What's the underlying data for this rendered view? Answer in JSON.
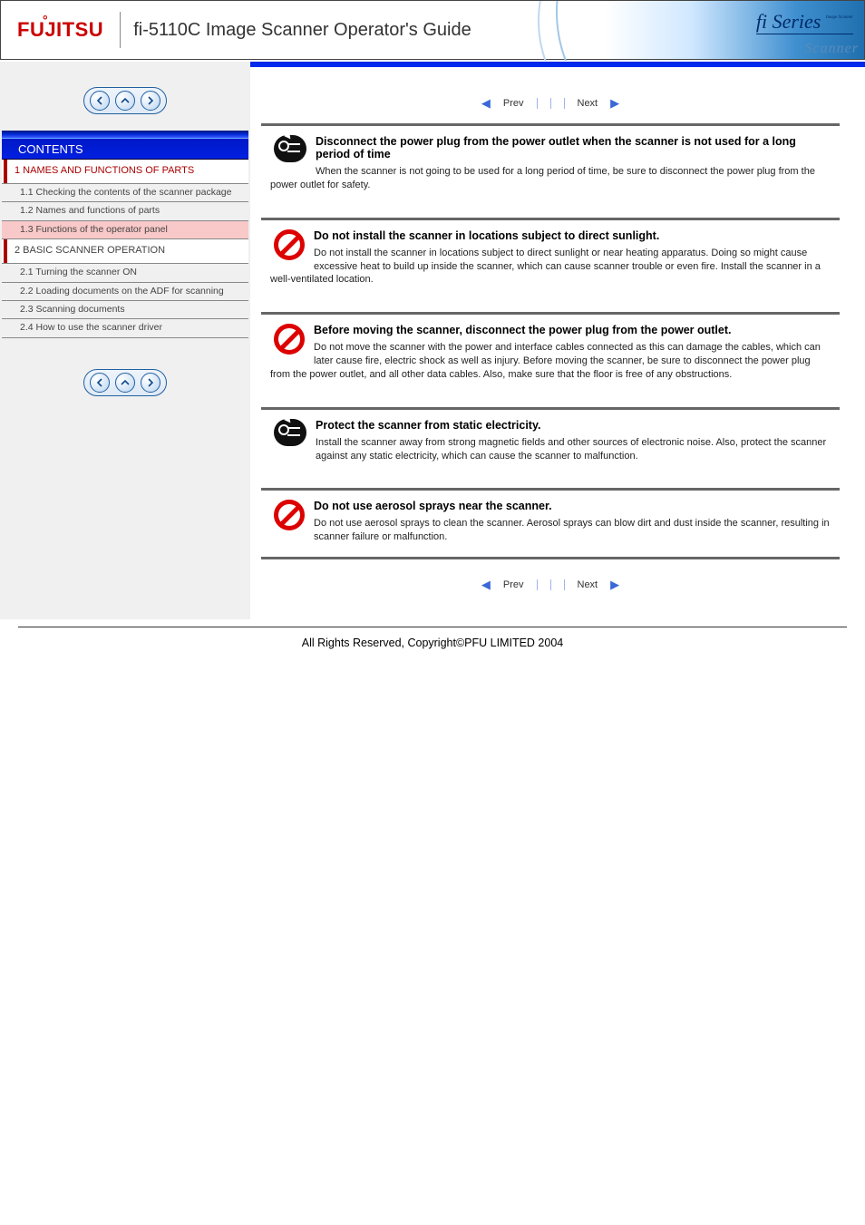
{
  "header": {
    "logo": "FUJITSU",
    "title": "fi-5110C  Image Scanner Operator's Guide",
    "series_label": "fi Series",
    "series_small": "Image Scanner",
    "banner_script": "Scanner"
  },
  "sidebar": {
    "contents_label": "CONTENTS",
    "section_header": "1 NAMES AND FUNCTIONS OF PARTS",
    "items": [
      {
        "label": "1.1 Checking the contents of the scanner package",
        "active": false
      },
      {
        "label": "1.2 Names and functions of parts",
        "active": false
      },
      {
        "label": "1.3 Functions of the operator panel",
        "active": true
      }
    ],
    "section_header_2": "2 BASIC SCANNER OPERATION",
    "items2": [
      {
        "label": "2.1 Turning the scanner ON"
      },
      {
        "label": "2.2 Loading documents on the ADF for scanning"
      },
      {
        "label": "2.3 Scanning documents"
      },
      {
        "label": "2.4 How to use the scanner driver"
      }
    ]
  },
  "pager_top": {
    "prev": "Prev",
    "next": "Next"
  },
  "boxes": [
    {
      "icon": "plug",
      "title": "Disconnect the power plug from the power outlet when the scanner is not used for a long period of time",
      "text": "When the scanner is not going to be used for a long period of time, be sure to disconnect the power plug from the power outlet for safety."
    },
    {
      "icon": "ban",
      "title": "Do not install the scanner in locations subject to direct sunlight.",
      "text": "Do not install the scanner in locations subject to direct sunlight or near heating apparatus. Doing so might cause excessive heat to build up inside the scanner, which can cause scanner trouble or even fire. Install the scanner in a well-ventilated location."
    },
    {
      "icon": "ban",
      "title": "Before moving the scanner, disconnect the power plug from the power outlet.",
      "text": "Do not move the scanner with the power and interface cables connected as this can damage the cables, which can later cause fire, electric shock as well as injury. Before moving the scanner, be sure to disconnect the power plug from the power outlet, and all other data cables. Also, make sure that the floor is free of any obstructions."
    },
    {
      "icon": "plug",
      "title": "Protect the scanner from static electricity.",
      "text": "Install the scanner away from strong magnetic fields and other sources of electronic noise. Also, protect the scanner against any static electricity, which can cause the scanner to malfunction."
    },
    {
      "icon": "ban",
      "title": "Do not use aerosol sprays near the scanner.",
      "text": "Do not use aerosol sprays to clean the scanner. Aerosol sprays can blow dirt and dust inside the scanner, resulting in scanner failure or malfunction."
    }
  ],
  "pager_bottom": {
    "prev": "Prev",
    "next": "Next"
  },
  "footer": {
    "copyright": "All Rights Reserved, Copyright©PFU LIMITED 2004"
  }
}
